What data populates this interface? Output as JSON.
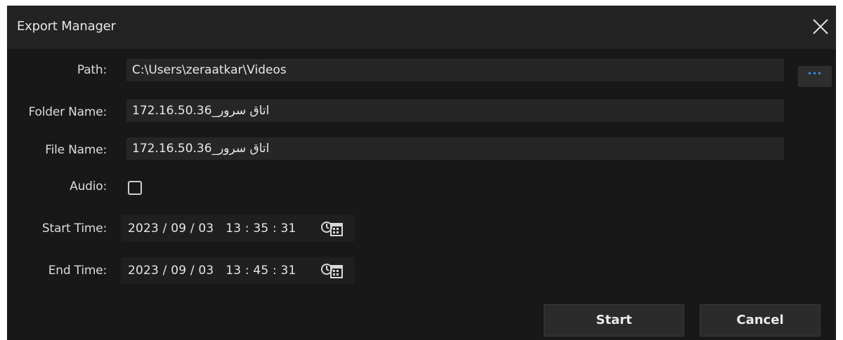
{
  "window": {
    "title": "Export Manager"
  },
  "form": {
    "path_label": "Path:",
    "path_value": "C:\\Users\\zeraatkar\\Videos",
    "browse_label": "···",
    "folder_label": "Folder Name:",
    "folder_value": "اتاق سرور_172.16.50.36",
    "file_label": "File Name:",
    "file_value": "اتاق سرور_172.16.50.36",
    "audio_label": "Audio:",
    "audio_checked": false,
    "start_label": "Start Time:",
    "start_value": "2023 / 09 / 03   13 : 35 : 31",
    "end_label": "End Time:",
    "end_value": "2023 / 09 / 03   13 : 45 : 31"
  },
  "buttons": {
    "start": "Start",
    "cancel": "Cancel"
  },
  "icons": {
    "close": "close-icon",
    "calendar": "clock-calendar-icon"
  },
  "colors": {
    "accent": "#3d8bff",
    "background": "#181818",
    "titlebar": "#232323"
  }
}
